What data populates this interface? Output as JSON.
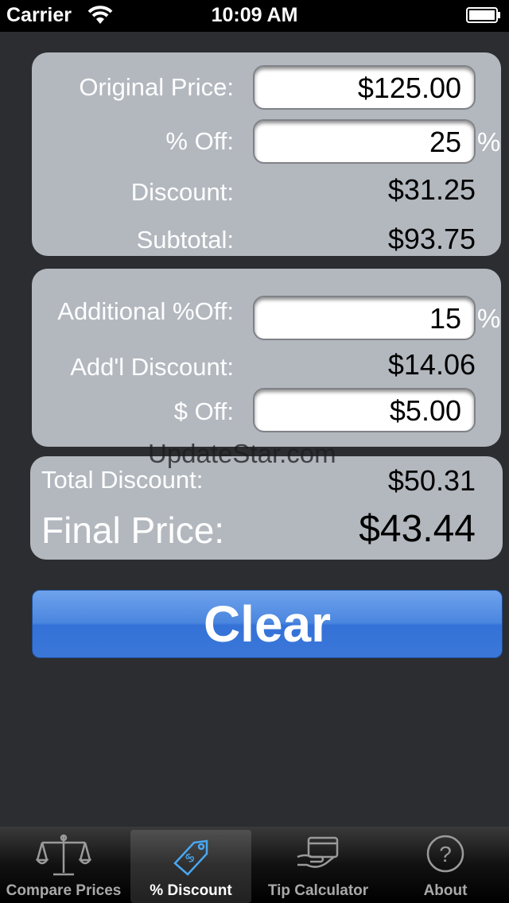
{
  "status_bar": {
    "carrier": "Carrier",
    "time": "10:09 AM"
  },
  "panel_price": {
    "original_price_label": "Original Price:",
    "original_price_value": "$125.00",
    "percent_off_label": "% Off:",
    "percent_off_value": "25",
    "percent_symbol": "%",
    "discount_label": "Discount:",
    "discount_value": "$31.25",
    "subtotal_label": "Subtotal:",
    "subtotal_value": "$93.75"
  },
  "panel_additional": {
    "additional_off_label": "Additional %Off:",
    "additional_off_value": "15",
    "percent_symbol": "%",
    "addl_discount_label": "Add'l Discount:",
    "addl_discount_value": "$14.06",
    "dollar_off_label": "$ Off:",
    "dollar_off_value": "$5.00"
  },
  "watermark": "UpdateStar.com",
  "panel_total": {
    "total_discount_label": "Total Discount:",
    "total_discount_value": "$50.31",
    "final_price_label": "Final Price:",
    "final_price_value": "$43.44"
  },
  "clear_button": "Clear",
  "tabs": [
    {
      "label": "Compare Prices",
      "icon": "scale-icon",
      "selected": false
    },
    {
      "label": "% Discount",
      "icon": "price-tag-icon",
      "selected": true
    },
    {
      "label": "Tip Calculator",
      "icon": "credit-card-icon",
      "selected": false
    },
    {
      "label": "About",
      "icon": "question-icon",
      "selected": false
    }
  ],
  "colors": {
    "background": "#2b2d30",
    "panel": "#b3b8bf",
    "button": "#4b86df"
  }
}
